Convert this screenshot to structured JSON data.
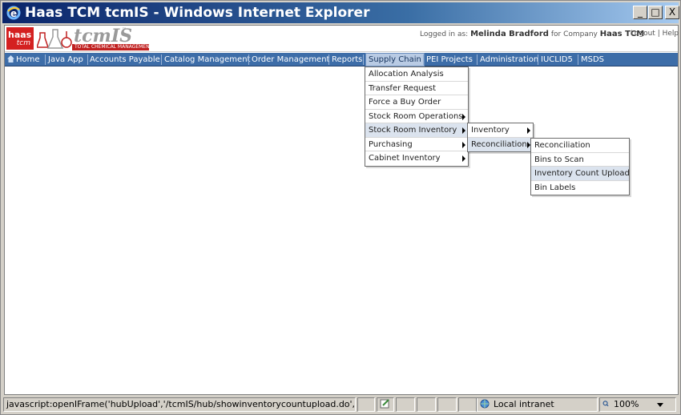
{
  "window": {
    "title": "Haas TCM tcmIS - Windows Internet Explorer",
    "min_label": "_",
    "max_label": "□",
    "close_label": "X"
  },
  "header": {
    "logo_top": "haas",
    "logo_sub": "tcm",
    "brand": "tcmIS",
    "brand_tm": "™",
    "brand_sub": "TOTAL CHEMICAL MANAGEMENT",
    "logged_in_prefix": "Logged in as:",
    "user": "Melinda Bradford",
    "company_prefix": "for Company",
    "company": "Haas TCM",
    "logout": "Logout",
    "help": "Help",
    "link_sep": "|"
  },
  "nav": {
    "items": [
      "Home",
      "Java App",
      "Accounts Payable",
      "Catalog Management",
      "Order Management",
      "Reports",
      "Supply Chain",
      "PEI Projects",
      "Administration",
      "IUCLID5",
      "MSDS"
    ],
    "active": "Supply Chain"
  },
  "menus": {
    "supply_chain": [
      "Allocation Analysis",
      "Transfer Request",
      "Force a Buy Order",
      "Stock Room Operations",
      "Stock Room Inventory",
      "Purchasing",
      "Cabinet Inventory"
    ],
    "stock_room_inventory": [
      "Inventory",
      "Reconciliation"
    ],
    "reconciliation": [
      "Reconciliation",
      "Bins to Scan",
      "Inventory Count Upload",
      "Bin Labels"
    ]
  },
  "status": {
    "url": "javascript:openIFrame('hubUpload','/tcmIS/hub/showinventorycountupload.do','Inventory Co",
    "zone": "Local intranet",
    "zoom": "100%"
  },
  "colors": {
    "nav_bg": "#3d6da8",
    "brand_red": "#d42020",
    "menu_highlight": "#dbe3ee"
  }
}
